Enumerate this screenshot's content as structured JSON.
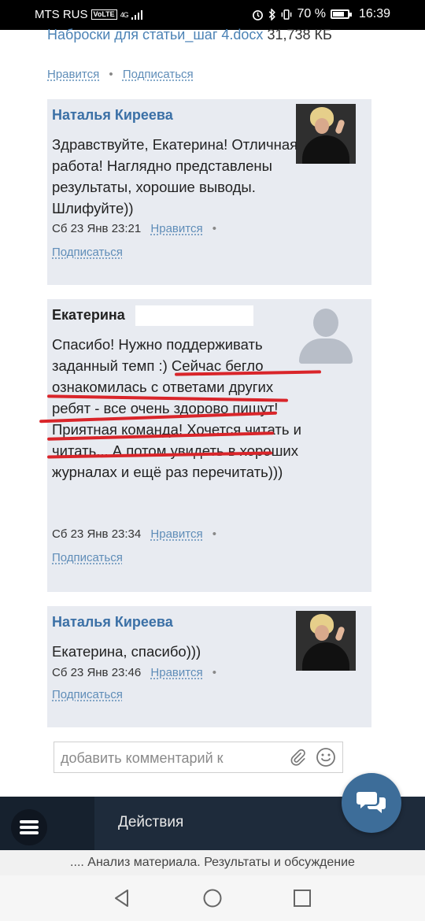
{
  "status_bar": {
    "carrier": "MTS RUS",
    "volte": "VoLTE",
    "network": "4G",
    "battery": "70 %",
    "time": "16:39"
  },
  "attachment": {
    "filename": "Наброски для статьи_шаг 4.docx",
    "size": "31,738 КБ"
  },
  "post_actions": {
    "like": "Нравится",
    "subscribe": "Подписаться"
  },
  "comments": [
    {
      "author": "Наталья Киреева",
      "text": "Здравствуйте, Екатерина! Отличная работа! Наглядно представлены результаты, хорошие выводы. Шлифуйте))",
      "date": "Сб 23 Янв 23:21",
      "like": "Нравится",
      "subscribe": "Подписаться"
    },
    {
      "author": "Екатерина",
      "text": "Спасибо! Нужно поддерживать заданный темп :) Сейчас бегло ознакомилась с ответами других ребят - все очень здорово пишут! Приятная команда! Хочется читать и читать... А потом увидеть в хороших журналах и ещё раз перечитать)))",
      "date": "Сб 23 Янв 23:34",
      "like": "Нравится",
      "subscribe": "Подписаться"
    },
    {
      "author": "Наталья Киреева",
      "text": "Екатерина, спасибо)))",
      "date": "Сб 23 Янв 23:46",
      "like": "Нравится",
      "subscribe": "Подписаться"
    }
  ],
  "comment_input": {
    "placeholder": "добавить комментарий к"
  },
  "bottom_bar": {
    "actions_label": "Действия"
  },
  "document_title": ".... Анализ материала. Результаты и обсуждение",
  "colors": {
    "link": "#5f8db8",
    "author": "#3b70a6",
    "card_bg": "#e8ebf1",
    "underline_mark": "#d9252a",
    "bottom_bar": "#1e2b3b",
    "fab": "#3d6d99"
  }
}
